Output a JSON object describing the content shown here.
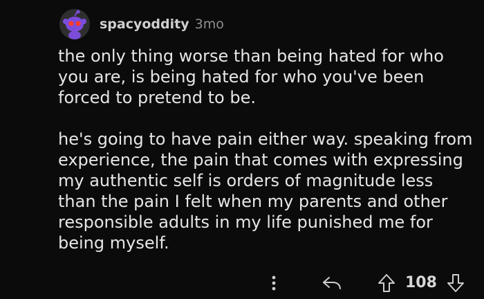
{
  "comment": {
    "author": "spacyoddity",
    "age": "3mo",
    "avatar_icon": "snoo-avatar-icon",
    "paragraphs": [
      "the only thing worse than being hated for who you are, is being hated for who you've been forced to pretend to be.",
      "he's going to have pain either way. speaking from experience, the pain that comes with expressing my authentic self is orders of magnitude less than the pain I felt when my parents and other responsible adults in my life punished me for being myself."
    ]
  },
  "actions": {
    "more_icon": "more-vertical-icon",
    "reply_icon": "reply-icon",
    "upvote_icon": "upvote-arrow-icon",
    "score": "108",
    "downvote_icon": "downvote-arrow-icon"
  },
  "colors": {
    "background": "#0b0b0b",
    "text": "#e6e6e6",
    "muted": "#8f8f8f",
    "avatar_purple": "#7c4ddb",
    "avatar_red": "#ff3c2e"
  }
}
